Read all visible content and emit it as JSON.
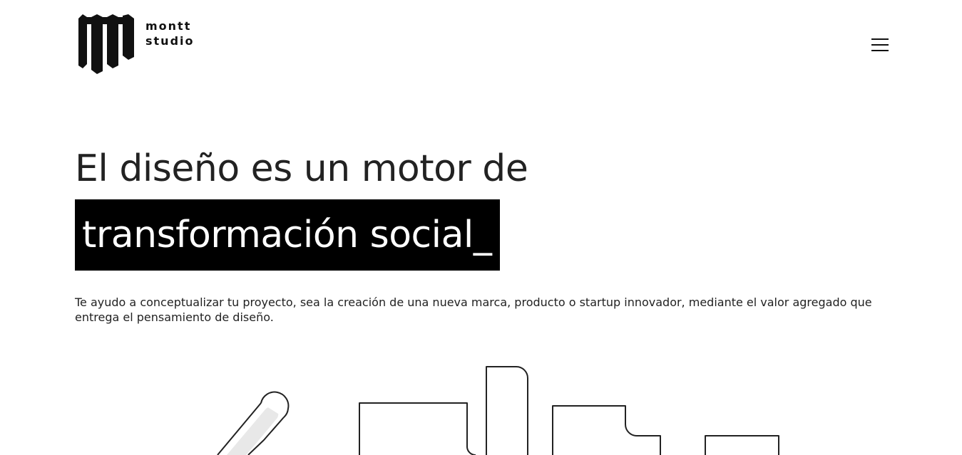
{
  "brand": {
    "line1": "montt",
    "line2": "studio"
  },
  "hero": {
    "headline": "El diseño es un motor de",
    "highlight": "transformación social_",
    "intro": "Te ayudo a conceptualizar tu proyecto, sea la creación de una nueva marca, producto o startup innovador, mediante el valor agregado que entrega el pensamiento de diseño."
  },
  "icons": {
    "logo": "montt-logo-icon",
    "menu": "hamburger-menu-icon"
  },
  "colors": {
    "text": "#222222",
    "highlight_bg": "#000000",
    "highlight_text": "#ffffff",
    "background": "#ffffff"
  }
}
